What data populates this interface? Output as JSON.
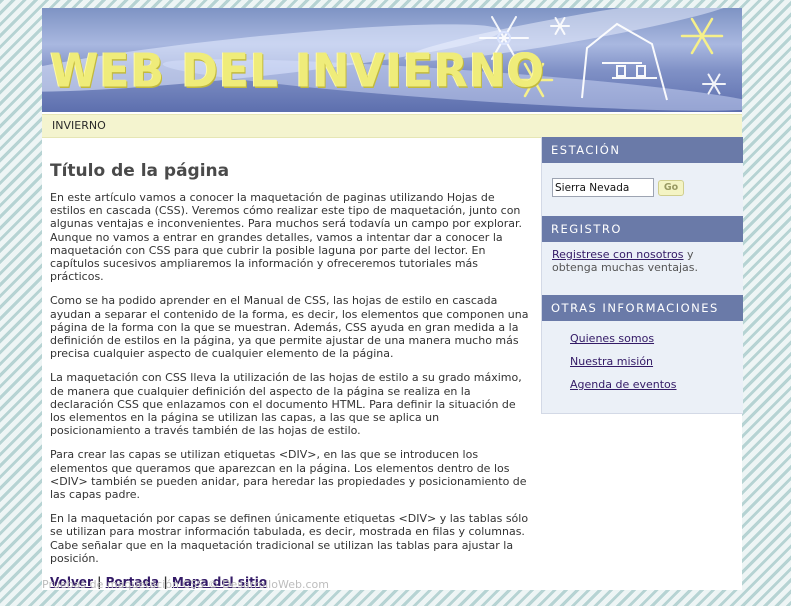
{
  "header": {
    "site_title": "WEB DEL INVIERNO"
  },
  "navbar": {
    "section_label": "INVIERNO"
  },
  "main": {
    "title": "Título de la página",
    "paragraphs": [
      "En este artículo vamos a conocer la maquetación de paginas utilizando Hojas de estilos en cascada (CSS). Veremos cómo realizar este tipo de maquetación, junto con algunas ventajas e inconvenientes. Para muchos será todavía un campo por explorar. Aunque no vamos a entrar en grandes detalles, vamos a intentar dar a conocer la maquetación con CSS para que cubrir la posible laguna por parte del lector. En capítulos sucesivos ampliaremos la información y ofreceremos tutoriales más prácticos.",
      "Como se ha podido aprender en el Manual de CSS, las hojas de estilo en cascada ayudan a separar el contenido de la forma, es decir, los elementos que componen una página de la forma con la que se muestran. Además, CSS ayuda en gran medida a la definición de estilos en la página, ya que permite ajustar de una manera mucho más precisa cualquier aspecto de cualquier elemento de la página.",
      "La maquetación con CSS lleva la utilización de las hojas de estilo a su grado máximo, de manera que cualquier definición del aspecto de la página se realiza en la declaración CSS que enlazamos con el documento HTML. Para definir la situación de los elementos en la página se utilizan las capas, a las que se aplica un posicionamiento a través también de las hojas de estilo.",
      "Para crear las capas se utilizan etiquetas <DIV>, en las que se introducen los elementos que queramos que aparezcan en la página. Los elementos dentro de los <DIV> también se pueden anidar, para heredar las propiedades y posicionamiento de las capas padre.",
      "En la maquetación por capas se definen únicamente etiquetas <DIV> y las tablas sólo se utilizan para mostrar información tabulada, es decir, mostrada en filas y columnas. Cabe señalar que en la maquetación tradicional se utilizan las tablas para ajustar la posición."
    ],
    "footer_links": {
      "back": "Volver",
      "home": "Portada",
      "sitemap": "Mapa del sitio",
      "separator": "|"
    },
    "copyright": "Pruebas de maquetación CSS © DesarrolloWeb.com"
  },
  "sidebar": {
    "estacion": {
      "heading": "ESTACIÓN",
      "search_value": "Sierra Nevada",
      "go_label": "Go"
    },
    "registro": {
      "heading": "REGISTRO",
      "link_text": "Registrese con nosotros",
      "rest_text": " y obtenga muchas ventajas."
    },
    "otras": {
      "heading": "OTRAS INFORMACIONES",
      "links": [
        "Quienes somos",
        "Nuestra misión",
        "Agenda de eventos"
      ]
    }
  },
  "colors": {
    "sidebar_heading_bg": "#6a7aa8",
    "navbar_bg": "#f4f4cf",
    "link": "#331a66",
    "title_yellow": "#efec7a"
  }
}
